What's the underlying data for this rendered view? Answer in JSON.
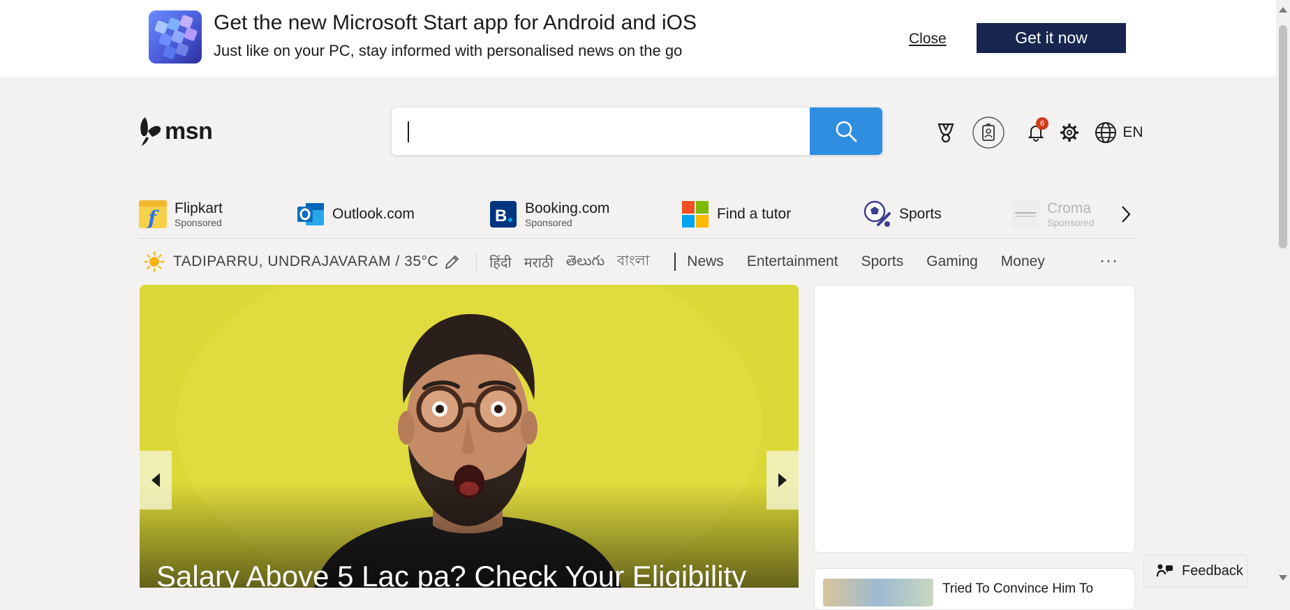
{
  "banner": {
    "title": "Get the new Microsoft Start app for Android and iOS",
    "subtitle": "Just like on your PC, stay informed with personalised news on the go",
    "close_label": "Close",
    "cta_label": "Get it now"
  },
  "header": {
    "logo_text": "msn",
    "search_placeholder": "",
    "search_value": "",
    "icons": [
      "rewards-trophy-icon",
      "profile-badge-icon",
      "bell-icon",
      "gear-icon",
      "globe-icon"
    ],
    "notification_count": "6",
    "language": "EN",
    "accent_color": "#2f8ee0"
  },
  "shortcuts": {
    "items": [
      {
        "label": "Flipkart",
        "sponsored": "Sponsored",
        "icon": "flipkart-icon"
      },
      {
        "label": "Outlook.com",
        "sponsored": "",
        "icon": "outlook-icon"
      },
      {
        "label": "Booking.com",
        "sponsored": "Sponsored",
        "icon": "booking-icon"
      },
      {
        "label": "Find a tutor",
        "sponsored": "",
        "icon": "microsoft-icon"
      },
      {
        "label": "Sports",
        "sponsored": "",
        "icon": "sports-icon"
      },
      {
        "label": "Croma",
        "sponsored": "Sponsored",
        "icon": "croma-icon"
      }
    ],
    "next_icon": "chevron-right-icon"
  },
  "nav": {
    "weather_location": "TADIPARRU, UNDRAJAVARAM / 35°C",
    "languages": [
      "हिंदी",
      "मराठी",
      "తెలుగు",
      "বাংলা"
    ],
    "links": [
      "News",
      "Entertainment",
      "Sports",
      "Gaming",
      "Money"
    ],
    "more": "···"
  },
  "hero": {
    "title": "Salary Above 5 Lac pa? Check Your Eligibility",
    "background_color": "#d8d633"
  },
  "teaser": {
    "text": "Tried To Convince Him To"
  },
  "feedback": {
    "label": "Feedback"
  }
}
